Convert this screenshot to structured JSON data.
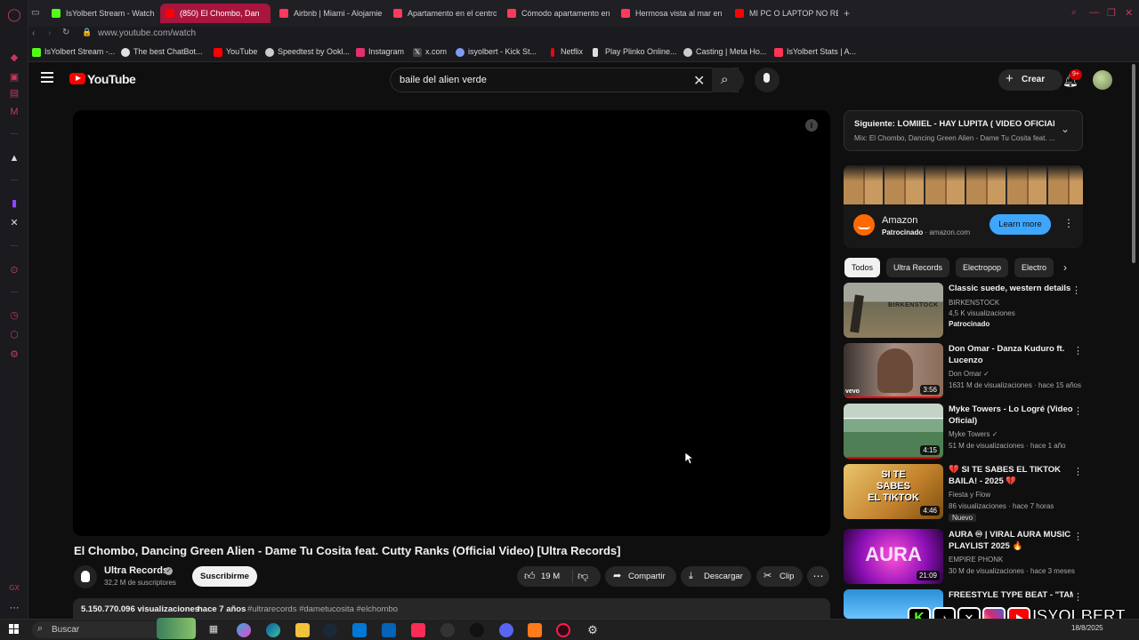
{
  "browser": {
    "tabs": [
      {
        "label": "IsYolbert Stream - Watch",
        "color": "#53fc18"
      },
      {
        "label": "(850) El Chombo, Dan",
        "color": "#ff0000"
      },
      {
        "label": "Airbnb | Miami - Alojamie",
        "color": "#ff385c"
      },
      {
        "label": "Apartamento en el centro",
        "color": "#ff385c"
      },
      {
        "label": "Cómodo apartamento en",
        "color": "#ff385c"
      },
      {
        "label": "Hermosa vista al mar en",
        "color": "#ff385c"
      },
      {
        "label": "MI PC O LAPTOP NO REC",
        "color": "#ff0000"
      }
    ],
    "url": "www.youtube.com/watch",
    "bookmarks": [
      {
        "label": "IsYolbert Stream -...",
        "color": "#53fc18"
      },
      {
        "label": "The best ChatBot...",
        "color": "#e0e0e0"
      },
      {
        "label": "YouTube",
        "color": "#ff0000"
      },
      {
        "label": "Speedtest by Ookl...",
        "color": "#cccccc"
      },
      {
        "label": "Instagram",
        "color": "#e1306c"
      },
      {
        "label": "x.com",
        "color": "#ffffff"
      },
      {
        "label": "isyolbert - Kick St...",
        "color": "#7f9cf5"
      },
      {
        "label": "Netflix",
        "color": "#e50914"
      },
      {
        "label": "Play Plinko Online...",
        "color": "#dddddd"
      },
      {
        "label": "Casting | Meta Ho...",
        "color": "#cccccc"
      },
      {
        "label": "IsYolbert Stats | A...",
        "color": "#ff3355"
      }
    ]
  },
  "youtube": {
    "logo": "YouTube",
    "search": {
      "value": "baile del alien verde"
    },
    "create_label": "Crear",
    "notif_count": "9+",
    "video": {
      "title": "El Chombo, Dancing Green Alien - Dame Tu Cosita feat. Cutty Ranks (Official Video) [Ultra Records]",
      "channel": "Ultra Records",
      "subscribers": "32,2 M de suscriptores",
      "subscribe_label": "Suscribirme",
      "likes": "19 M",
      "share_label": "Compartir",
      "download_label": "Descargar",
      "clip_label": "Clip",
      "views": "5.150.770.096 visualizaciones",
      "age": "hace 7 años",
      "hashtags": "#ultrarecords #dametucosita #elchombo"
    },
    "next_panel": {
      "title": "Siguiente: LOMIIEL - HAY LUPITA ( VIDEO OFICIAL ...",
      "subtitle": "Mix: El Chombo, Dancing Green Alien - Dame Tu Cosita feat. ..."
    },
    "ad": {
      "name": "Amazon",
      "sponsored": "Patrocinado",
      "domain": "amazon.com",
      "cta": "Learn more"
    },
    "chips": [
      "Todos",
      "Ultra Records",
      "Electropop",
      "Electro"
    ],
    "recommendations": [
      {
        "title": "Classic suede, western details",
        "channel": "BIRKENSTOCK",
        "meta": "4,5 K visualizaciones",
        "badge": "Patrocinado",
        "duration": "",
        "thumb": "birkenstock"
      },
      {
        "title": "Don Omar - Danza Kuduro ft. Lucenzo",
        "channel": "Don Omar",
        "meta": "1631 M de visualizaciones · hace 15 años",
        "badge": "",
        "duration": "3:56",
        "thumb": "vevo"
      },
      {
        "title": "Myke Towers - Lo Logré (Video Oficial)",
        "channel": "Myke Towers",
        "meta": "51 M de visualizaciones · hace 1 año",
        "badge": "",
        "duration": "4:15",
        "thumb": "field"
      },
      {
        "title": "💔 SI TE SABES EL TIKTOK BAILA! - 2025 💔",
        "channel": "Fiesta y Flow",
        "meta": "86 visualizaciones · hace 7 horas",
        "badge": "Nuevo",
        "duration": "4:46",
        "thumb": "tiktok"
      },
      {
        "title": "AURA ♾ | VIRAL AURA MUSIC PLAYLIST 2025 🔥",
        "channel": "EMPIRE PHONK",
        "meta": "30 M de visualizaciones · hace 3 meses",
        "badge": "",
        "duration": "21:09",
        "thumb": "aura"
      },
      {
        "title": "FREESTYLE TYPE BEAT - \"TAM",
        "channel": "",
        "meta": "",
        "badge": "",
        "duration": "",
        "thumb": "beat"
      }
    ]
  },
  "taskbar": {
    "search_label": "Buscar",
    "date": "18/8/2025"
  },
  "overlay": {
    "brand": "ISYOLBERT"
  }
}
